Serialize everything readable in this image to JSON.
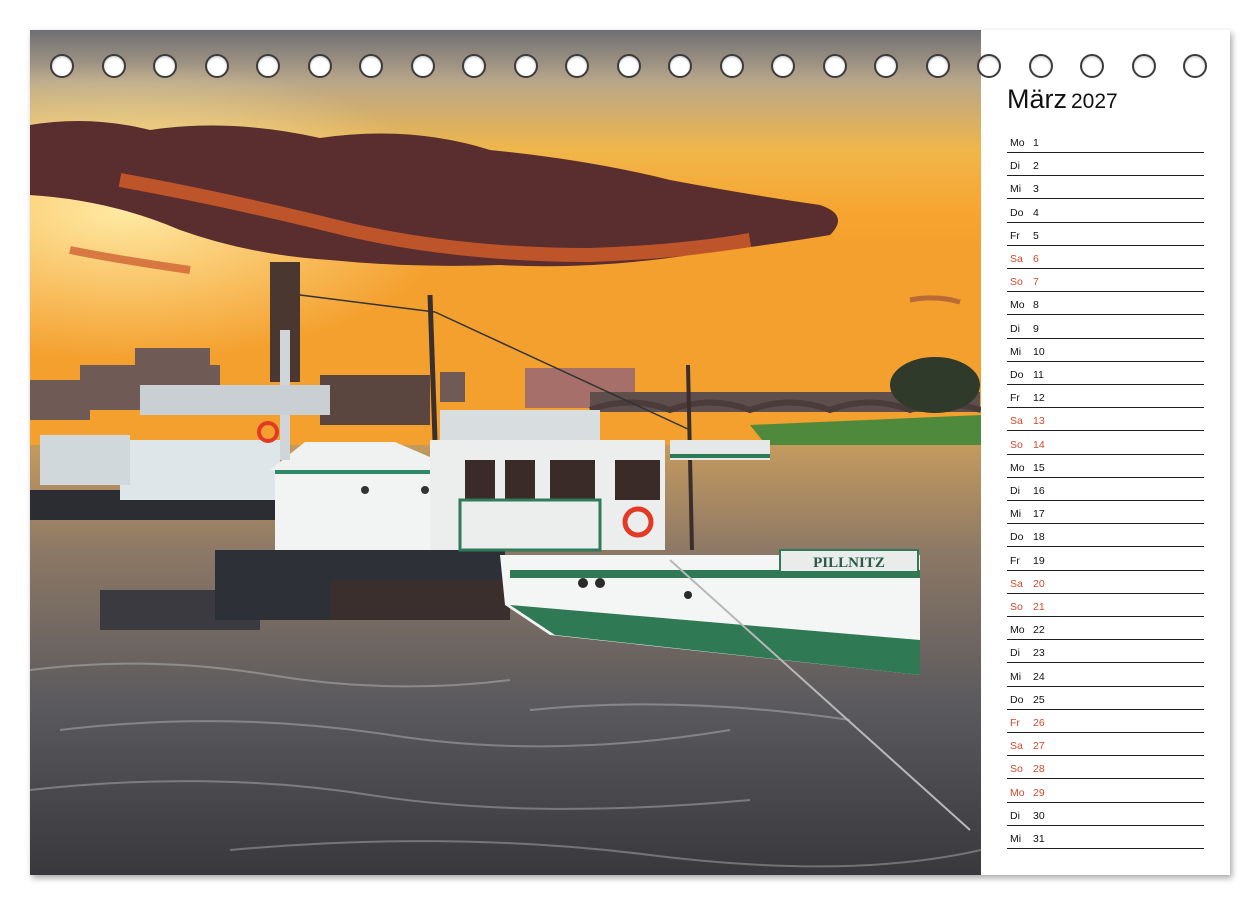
{
  "calendar": {
    "month": "März",
    "year": "2027",
    "holiday_color": "#d24a2b",
    "days": [
      {
        "abbr": "Mo",
        "num": "1",
        "holiday": false
      },
      {
        "abbr": "Di",
        "num": "2",
        "holiday": false
      },
      {
        "abbr": "Mi",
        "num": "3",
        "holiday": false
      },
      {
        "abbr": "Do",
        "num": "4",
        "holiday": false
      },
      {
        "abbr": "Fr",
        "num": "5",
        "holiday": false
      },
      {
        "abbr": "Sa",
        "num": "6",
        "holiday": true
      },
      {
        "abbr": "So",
        "num": "7",
        "holiday": true
      },
      {
        "abbr": "Mo",
        "num": "8",
        "holiday": false
      },
      {
        "abbr": "Di",
        "num": "9",
        "holiday": false
      },
      {
        "abbr": "Mi",
        "num": "10",
        "holiday": false
      },
      {
        "abbr": "Do",
        "num": "11",
        "holiday": false
      },
      {
        "abbr": "Fr",
        "num": "12",
        "holiday": false
      },
      {
        "abbr": "Sa",
        "num": "13",
        "holiday": true
      },
      {
        "abbr": "So",
        "num": "14",
        "holiday": true
      },
      {
        "abbr": "Mo",
        "num": "15",
        "holiday": false
      },
      {
        "abbr": "Di",
        "num": "16",
        "holiday": false
      },
      {
        "abbr": "Mi",
        "num": "17",
        "holiday": false
      },
      {
        "abbr": "Do",
        "num": "18",
        "holiday": false
      },
      {
        "abbr": "Fr",
        "num": "19",
        "holiday": false
      },
      {
        "abbr": "Sa",
        "num": "20",
        "holiday": true
      },
      {
        "abbr": "So",
        "num": "21",
        "holiday": true
      },
      {
        "abbr": "Mo",
        "num": "22",
        "holiday": false
      },
      {
        "abbr": "Di",
        "num": "23",
        "holiday": false
      },
      {
        "abbr": "Mi",
        "num": "24",
        "holiday": false
      },
      {
        "abbr": "Do",
        "num": "25",
        "holiday": false
      },
      {
        "abbr": "Fr",
        "num": "26",
        "holiday": true
      },
      {
        "abbr": "Sa",
        "num": "27",
        "holiday": true
      },
      {
        "abbr": "So",
        "num": "28",
        "holiday": true
      },
      {
        "abbr": "Mo",
        "num": "29",
        "holiday": true
      },
      {
        "abbr": "Di",
        "num": "30",
        "holiday": false
      },
      {
        "abbr": "Mi",
        "num": "31",
        "holiday": false
      }
    ]
  },
  "photo": {
    "boat_name": "PILLNITZ"
  }
}
